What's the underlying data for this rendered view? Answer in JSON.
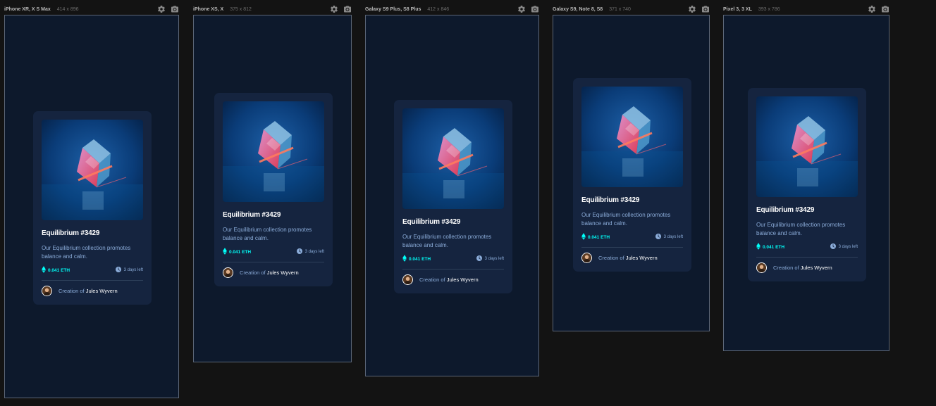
{
  "colors": {
    "page_bg": "#131313",
    "screen_bg": "#0d192c",
    "card_bg": "#15243f",
    "accent_cyan": "#00fff8",
    "soft_blue": "#8bacd9",
    "white": "#ffffff"
  },
  "icons": {
    "settings": "gear-icon",
    "screenshot": "camera-icon",
    "price": "ethereum-icon",
    "time": "clock-icon"
  },
  "devices": [
    {
      "name": "iPhone XR, X S Max",
      "dims": "414 x 896"
    },
    {
      "name": "iPhone XS, X",
      "dims": "375 x 812"
    },
    {
      "name": "Galaxy S9 Plus, S8 Plus",
      "dims": "412 x 846"
    },
    {
      "name": "Galaxy S9, Note 8, S8",
      "dims": "371 x 740"
    },
    {
      "name": "Pixel 3, 3 XL",
      "dims": "393 x 786"
    }
  ],
  "card": {
    "title": "Equilibrium #3429",
    "description": "Our Equilibrium collection promotes balance and calm.",
    "price": "0.041 ETH",
    "time_left": "3 days left",
    "creator_prefix": "Creation of",
    "creator_name": "Jules Wyvern"
  }
}
